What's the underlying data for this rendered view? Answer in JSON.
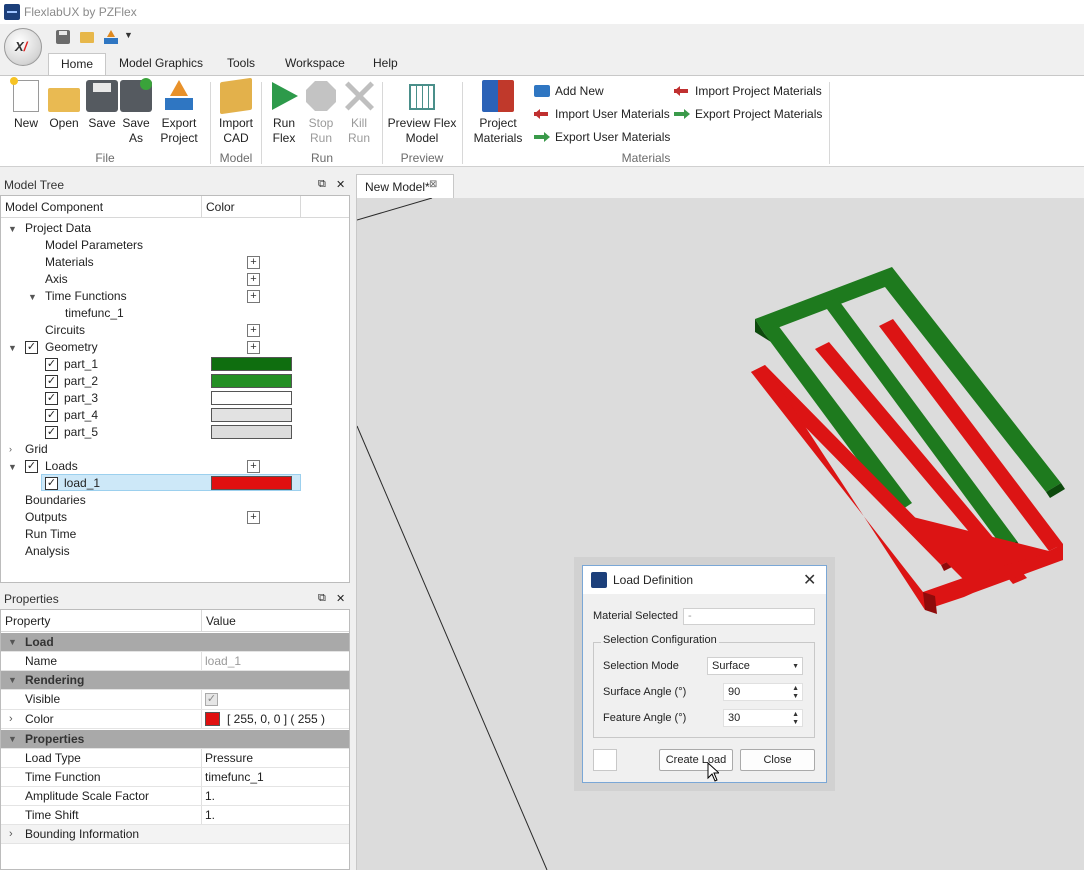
{
  "app": {
    "title": "FlexlabUX by PZFlex"
  },
  "ribbon": {
    "tabs": [
      "Home",
      "Model Graphics",
      "Tools",
      "Workspace",
      "Help"
    ],
    "file": {
      "new": "New",
      "open": "Open",
      "save": "Save",
      "save_as_1": "Save",
      "save_as_2": "As",
      "export_1": "Export",
      "export_2": "Project",
      "group": "File"
    },
    "model": {
      "import_1": "Import",
      "import_2": "CAD",
      "group": "Model"
    },
    "run": {
      "run_1": "Run",
      "run_2": "Flex",
      "stop_1": "Stop",
      "stop_2": "Run",
      "kill_1": "Kill",
      "kill_2": "Run",
      "group": "Run"
    },
    "preview": {
      "btn_1": "Preview Flex",
      "btn_2": "Model",
      "group": "Preview"
    },
    "materials": {
      "project_1": "Project",
      "project_2": "Materials",
      "add_new": "Add New",
      "import_user": "Import User Materials",
      "export_user": "Export User Materials",
      "import_project": "Import Project Materials",
      "export_project": "Export Project Materials",
      "group": "Materials"
    }
  },
  "tree": {
    "title": "Model Tree",
    "col_component": "Model Component",
    "col_color": "Color",
    "items": {
      "project_data": "Project Data",
      "model_params": "Model Parameters",
      "materials": "Materials",
      "axis": "Axis",
      "time_functions": "Time Functions",
      "timefunc": "timefunc_1",
      "circuits": "Circuits",
      "geometry": "Geometry",
      "part_1": "part_1",
      "part_2": "part_2",
      "part_3": "part_3",
      "part_4": "part_4",
      "part_5": "part_5",
      "grid": "Grid",
      "loads": "Loads",
      "load_1": "load_1",
      "boundaries": "Boundaries",
      "outputs": "Outputs",
      "run_time": "Run Time",
      "analysis": "Analysis"
    },
    "colors": {
      "part_1": "#0f6e0f",
      "part_2": "#248f24",
      "part_3": "#ffffff",
      "part_4": "#e2e2e2",
      "part_5": "#dcdcdc",
      "load_1": "#e01010"
    }
  },
  "properties": {
    "title": "Properties",
    "col_property": "Property",
    "col_value": "Value",
    "cat_load": "Load",
    "name_key": "Name",
    "name_val": "load_1",
    "cat_rendering": "Rendering",
    "visible_key": "Visible",
    "color_key": "Color",
    "color_val": "[ 255, 0, 0 ] ( 255 )",
    "cat_properties": "Properties",
    "load_type_key": "Load Type",
    "load_type_val": "Pressure",
    "time_fn_key": "Time Function",
    "time_fn_val": "timefunc_1",
    "amp_key": "Amplitude Scale Factor",
    "amp_val": "1.",
    "shift_key": "Time Shift",
    "shift_val": "1.",
    "bounding_key": "Bounding Information"
  },
  "document": {
    "tab_label": "New Model*"
  },
  "dialog": {
    "title": "Load Definition",
    "material_label": "Material Selected",
    "material_value": "-",
    "group_title": "Selection Configuration",
    "mode_label": "Selection Mode",
    "mode_value": "Surface",
    "surface_label": "Surface Angle (°)",
    "surface_value": "90",
    "feature_label": "Feature Angle (°)",
    "feature_value": "30",
    "create_btn": "Create Load",
    "close_btn": "Close"
  }
}
